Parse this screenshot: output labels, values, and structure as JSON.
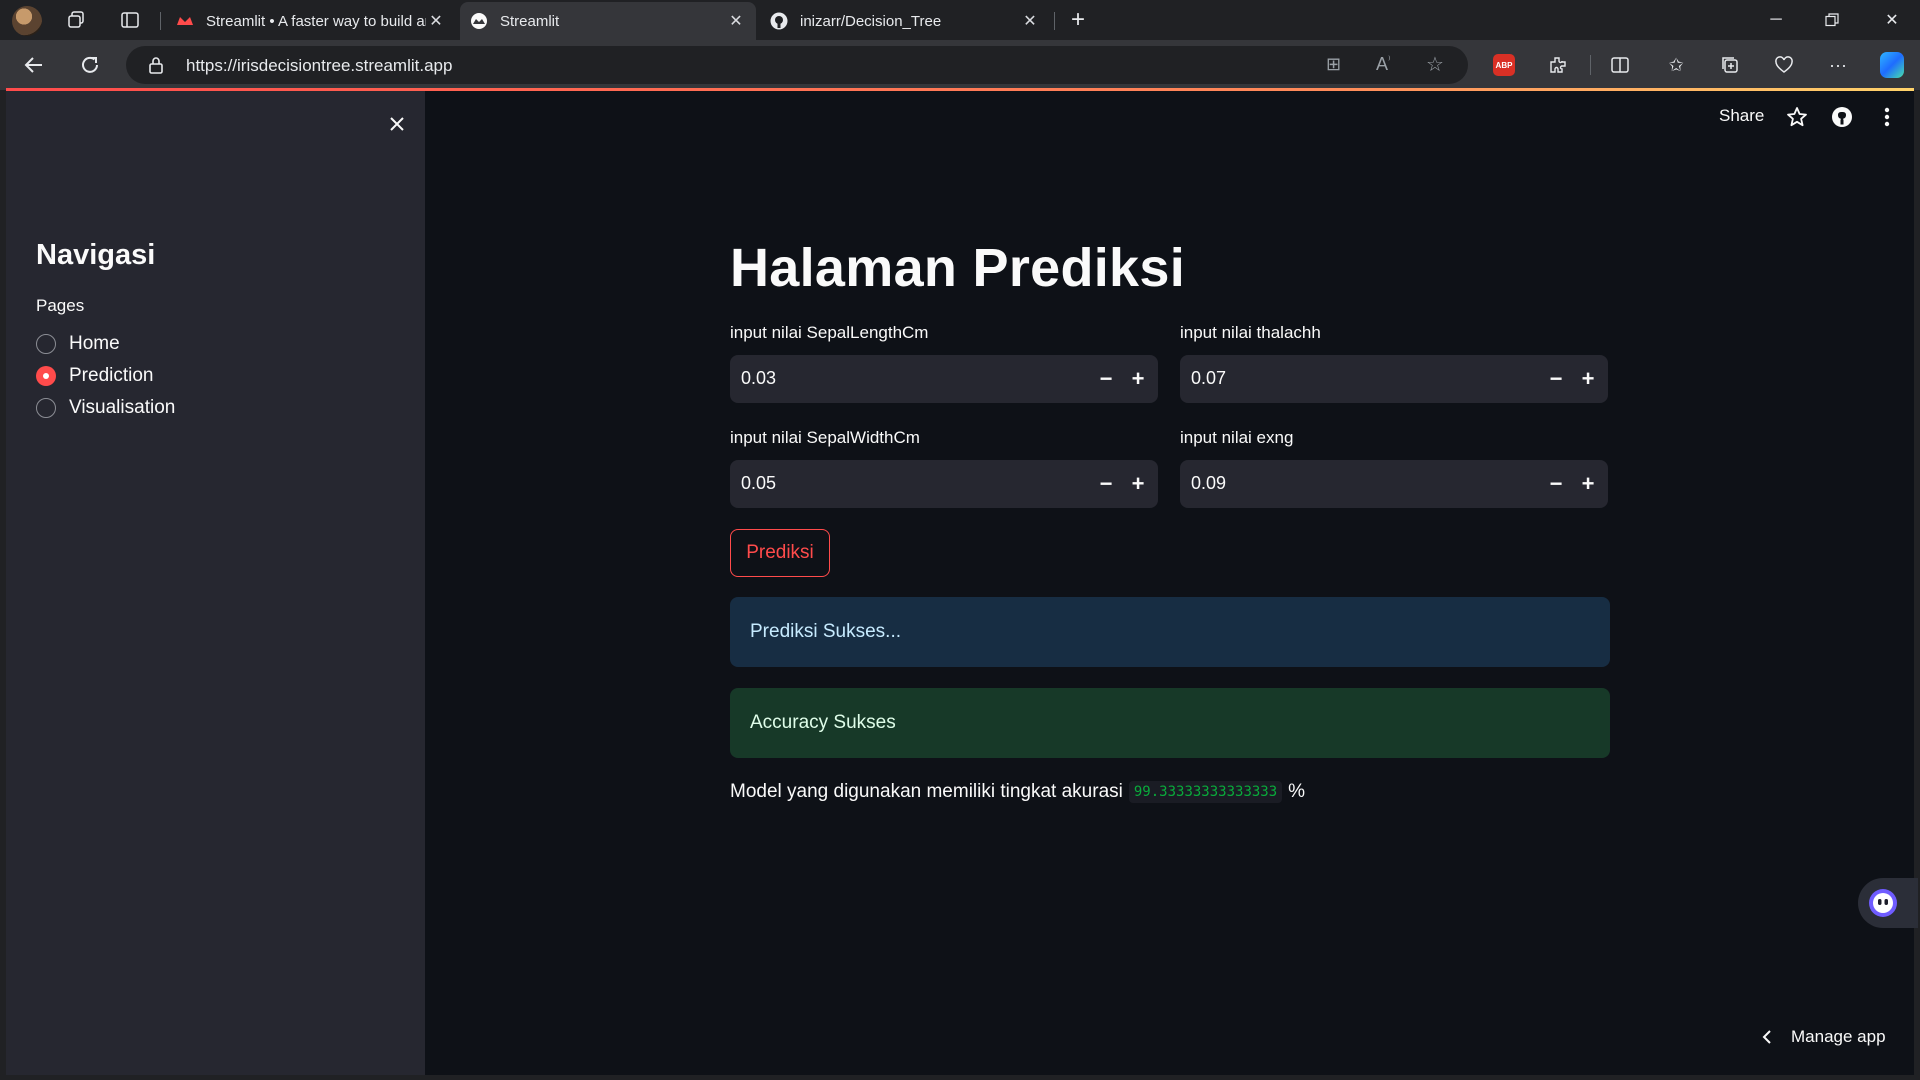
{
  "browser": {
    "tabs": [
      {
        "title": "Streamlit • A faster way to build and share data apps",
        "icon": "streamlit-crown-icon",
        "active": false
      },
      {
        "title": "Streamlit",
        "icon": "streamlit-icon",
        "active": true
      },
      {
        "title": "inizarr/Decision_Tree",
        "icon": "github-icon",
        "active": false
      }
    ],
    "url": "https://irisdecisiontree.streamlit.app"
  },
  "header": {
    "share_label": "Share"
  },
  "sidebar": {
    "title": "Navigasi",
    "pages_label": "Pages",
    "pages": [
      {
        "label": "Home",
        "selected": false
      },
      {
        "label": "Prediction",
        "selected": true
      },
      {
        "label": "Visualisation",
        "selected": false
      }
    ]
  },
  "main": {
    "title": "Halaman Prediksi",
    "inputs": [
      {
        "label": "input nilai SepalLengthCm",
        "value": "0.03"
      },
      {
        "label": "input nilai thalachh",
        "value": "0.07"
      },
      {
        "label": "input nilai SepalWidthCm",
        "value": "0.05"
      },
      {
        "label": "input nilai exng",
        "value": "0.09"
      }
    ],
    "predict_button": "Prediksi",
    "info_message": "Prediksi Sukses...",
    "success_message": "Accuracy Sukses",
    "accuracy_text": "Model yang digunakan memiliki tingkat akurasi",
    "accuracy_value": "99.33333333333333",
    "accuracy_unit": "%"
  },
  "footer": {
    "manage_app": "Manage app"
  },
  "colors": {
    "primary": "#ff4b4b",
    "background": "#0e1117",
    "sidebar_bg": "#262730",
    "info_bg": "#172d43",
    "success_bg": "#173928",
    "code_green": "#09ab3b"
  }
}
